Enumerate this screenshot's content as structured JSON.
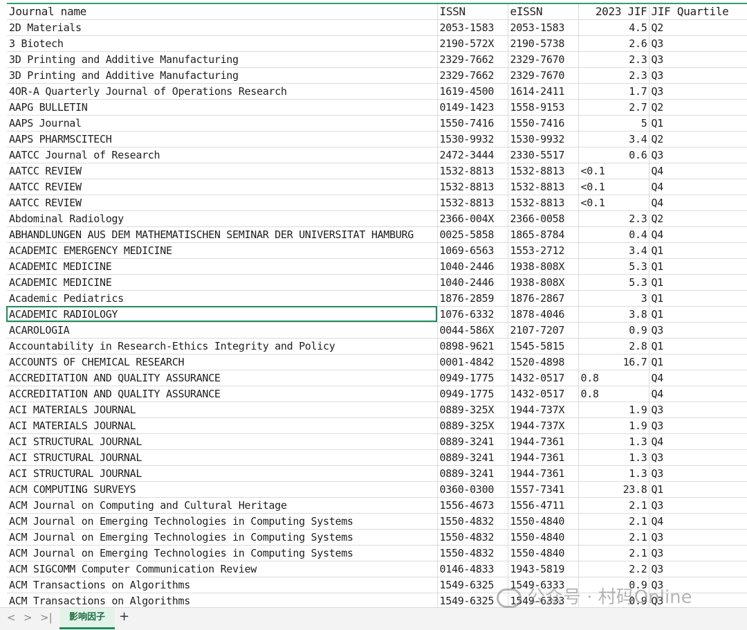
{
  "columns": [
    "Journal name",
    "ISSN",
    "eISSN",
    "2023 JIF",
    "JIF Quartile"
  ],
  "rows": [
    [
      "2D Materials",
      "2053-1583",
      "2053-1583",
      "4.5",
      "Q2"
    ],
    [
      "3 Biotech",
      "2190-572X",
      "2190-5738",
      "2.6",
      "Q3"
    ],
    [
      "3D Printing and Additive Manufacturing",
      "2329-7662",
      "2329-7670",
      "2.3",
      "Q3"
    ],
    [
      "3D Printing and Additive Manufacturing",
      "2329-7662",
      "2329-7670",
      "2.3",
      "Q3"
    ],
    [
      "4OR-A Quarterly Journal of Operations Research",
      "1619-4500",
      "1614-2411",
      "1.7",
      "Q3"
    ],
    [
      "AAPG BULLETIN",
      "0149-1423",
      "1558-9153",
      "2.7",
      "Q2"
    ],
    [
      "AAPS Journal",
      "1550-7416",
      "1550-7416",
      "5",
      "Q1"
    ],
    [
      "AAPS PHARMSCITECH",
      "1530-9932",
      "1530-9932",
      "3.4",
      "Q2"
    ],
    [
      "AATCC Journal of Research",
      "2472-3444",
      "2330-5517",
      "0.6",
      "Q3"
    ],
    [
      "AATCC REVIEW",
      "1532-8813",
      "1532-8813",
      "<0.1",
      "Q4"
    ],
    [
      "AATCC REVIEW",
      "1532-8813",
      "1532-8813",
      "<0.1",
      "Q4"
    ],
    [
      "AATCC REVIEW",
      "1532-8813",
      "1532-8813",
      "<0.1",
      "Q4"
    ],
    [
      "Abdominal Radiology",
      "2366-004X",
      "2366-0058",
      "2.3",
      "Q2"
    ],
    [
      "ABHANDLUNGEN AUS DEM MATHEMATISCHEN SEMINAR DER UNIVERSITAT HAMBURG",
      "0025-5858",
      "1865-8784",
      "0.4",
      "Q4"
    ],
    [
      "ACADEMIC EMERGENCY MEDICINE",
      "1069-6563",
      "1553-2712",
      "3.4",
      "Q1"
    ],
    [
      "ACADEMIC MEDICINE",
      "1040-2446",
      "1938-808X",
      "5.3",
      "Q1"
    ],
    [
      "ACADEMIC MEDICINE",
      "1040-2446",
      "1938-808X",
      "5.3",
      "Q1"
    ],
    [
      "Academic Pediatrics",
      "1876-2859",
      "1876-2867",
      "3",
      "Q1"
    ],
    [
      "ACADEMIC RADIOLOGY",
      "1076-6332",
      "1878-4046",
      "3.8",
      "Q1"
    ],
    [
      "ACAROLOGIA",
      "0044-586X",
      "2107-7207",
      "0.9",
      "Q3"
    ],
    [
      "Accountability in Research-Ethics Integrity and Policy",
      "0898-9621",
      "1545-5815",
      "2.8",
      "Q1"
    ],
    [
      "ACCOUNTS OF CHEMICAL RESEARCH",
      "0001-4842",
      "1520-4898",
      "16.7",
      "Q1"
    ],
    [
      "ACCREDITATION AND QUALITY ASSURANCE",
      "0949-1775",
      "1432-0517",
      "0.8",
      "Q4"
    ],
    [
      "ACCREDITATION AND QUALITY ASSURANCE",
      "0949-1775",
      "1432-0517",
      "0.8",
      "Q4"
    ],
    [
      "ACI MATERIALS JOURNAL",
      "0889-325X",
      "1944-737X",
      "1.9",
      "Q3"
    ],
    [
      "ACI MATERIALS JOURNAL",
      "0889-325X",
      "1944-737X",
      "1.9",
      "Q3"
    ],
    [
      "ACI STRUCTURAL JOURNAL",
      "0889-3241",
      "1944-7361",
      "1.3",
      "Q4"
    ],
    [
      "ACI STRUCTURAL JOURNAL",
      "0889-3241",
      "1944-7361",
      "1.3",
      "Q3"
    ],
    [
      "ACI STRUCTURAL JOURNAL",
      "0889-3241",
      "1944-7361",
      "1.3",
      "Q3"
    ],
    [
      "ACM COMPUTING SURVEYS",
      "0360-0300",
      "1557-7341",
      "23.8",
      "Q1"
    ],
    [
      "ACM Journal on Computing and Cultural Heritage",
      "1556-4673",
      "1556-4711",
      "2.1",
      "Q3"
    ],
    [
      "ACM Journal on Emerging Technologies in Computing Systems",
      "1550-4832",
      "1550-4840",
      "2.1",
      "Q4"
    ],
    [
      "ACM Journal on Emerging Technologies in Computing Systems",
      "1550-4832",
      "1550-4840",
      "2.1",
      "Q3"
    ],
    [
      "ACM Journal on Emerging Technologies in Computing Systems",
      "1550-4832",
      "1550-4840",
      "2.1",
      "Q3"
    ],
    [
      "ACM SIGCOMM Computer Communication Review",
      "0146-4833",
      "1943-5819",
      "2.2",
      "Q3"
    ],
    [
      "ACM Transactions on Algorithms",
      "1549-6325",
      "1549-6333",
      "0.9",
      "Q3"
    ],
    [
      "ACM Transactions on Algorithms",
      "1549-6325",
      "1549-6333",
      "0.9",
      "Q3"
    ]
  ],
  "sheet_tabs": [
    "影响因子"
  ],
  "add_tab_label": "+",
  "nav": {
    "first": "<",
    "prev": ">",
    "last": ">|"
  },
  "watermark": "公众号 · 村码Online"
}
